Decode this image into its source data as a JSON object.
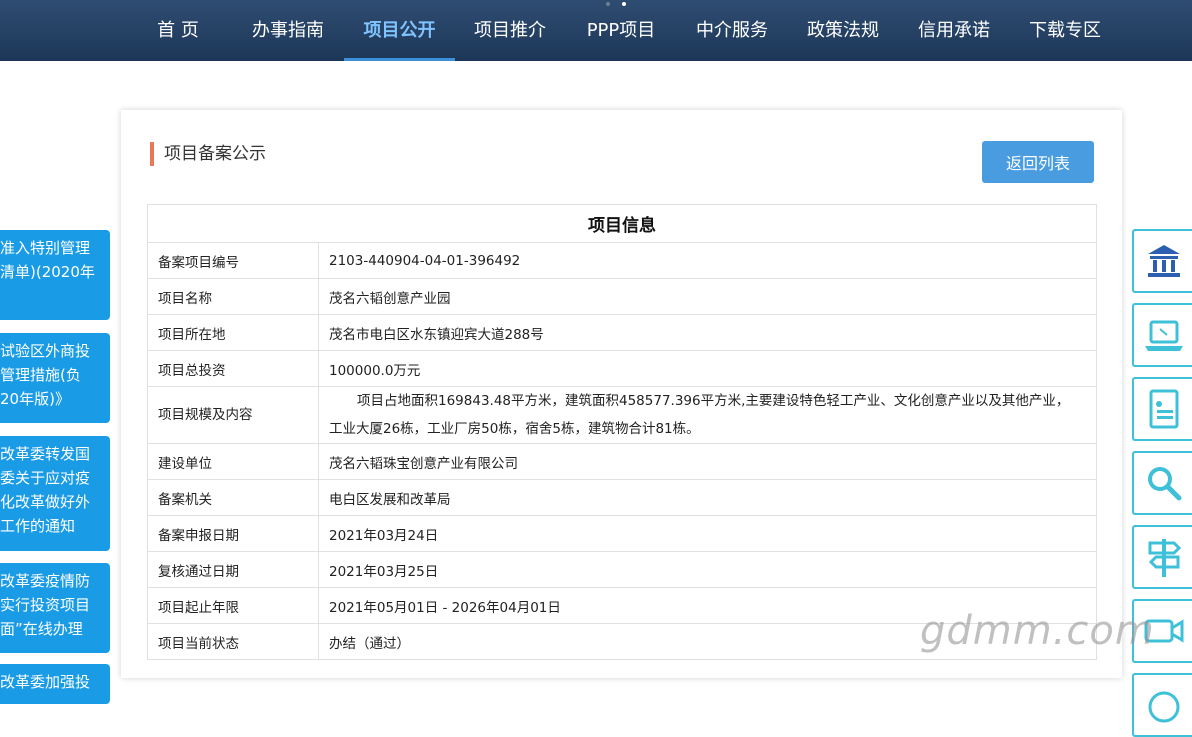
{
  "nav": {
    "items": [
      "首 页",
      "办事指南",
      "项目公开",
      "项目推介",
      "PPP项目",
      "中介服务",
      "政策法规",
      "信用承诺",
      "下载专区"
    ],
    "active_index": 2
  },
  "side_cards": [
    [
      "准入特别管理",
      "清单)(2020年"
    ],
    [
      "试验区外商投",
      "管理措施(负",
      "20年版)》"
    ],
    [
      "改革委转发国",
      "委关于应对疫",
      "化改革做好外",
      "工作的通知"
    ],
    [
      "改革委疫情防",
      "实行投资项目",
      "面”在线办理"
    ],
    [
      "改革委加强投"
    ]
  ],
  "panel": {
    "title": "项目备案公示",
    "back_button": "返回列表",
    "table_header": "项目信息",
    "rows": [
      {
        "label": "备案项目编号",
        "value": "2103-440904-04-01-396492"
      },
      {
        "label": "项目名称",
        "value": "茂名六韬创意产业园"
      },
      {
        "label": "项目所在地",
        "value": "茂名市电白区水东镇迎宾大道288号"
      },
      {
        "label": "项目总投资",
        "value": "100000.0万元"
      },
      {
        "label": "项目规模及内容",
        "value_line1": "项目占地面积169843.48平方米，建筑面积458577.396平方米,主要建设特色轻工产业、文化创意产业以及其他产业，",
        "value_line2": "工业大厦26栋，工业厂房50栋，宿舍5栋，建筑物合计81栋。"
      },
      {
        "label": "建设单位",
        "value": "茂名六韬珠宝创意产业有限公司"
      },
      {
        "label": "备案机关",
        "value": "电白区发展和改革局"
      },
      {
        "label": "备案申报日期",
        "value": "2021年03月24日"
      },
      {
        "label": "复核通过日期",
        "value": "2021年03月25日"
      },
      {
        "label": "项目起止年限",
        "value": "2021年05月01日 - 2026年04月01日"
      },
      {
        "label": "项目当前状态",
        "value": "办结（通过）"
      }
    ]
  },
  "right_rail": [
    "government-building-icon",
    "laptop-icon",
    "document-list-icon",
    "search-icon",
    "signpost-icon",
    "video-camera-icon",
    "chat-icon"
  ],
  "watermark": "gdmm.com",
  "colors": {
    "nav_bg": "#1c3657",
    "accent_blue": "#4a9ce0",
    "card_blue": "#1a9be6",
    "rail_cyan": "#3ec1d8",
    "title_bar": "#e8785a"
  }
}
